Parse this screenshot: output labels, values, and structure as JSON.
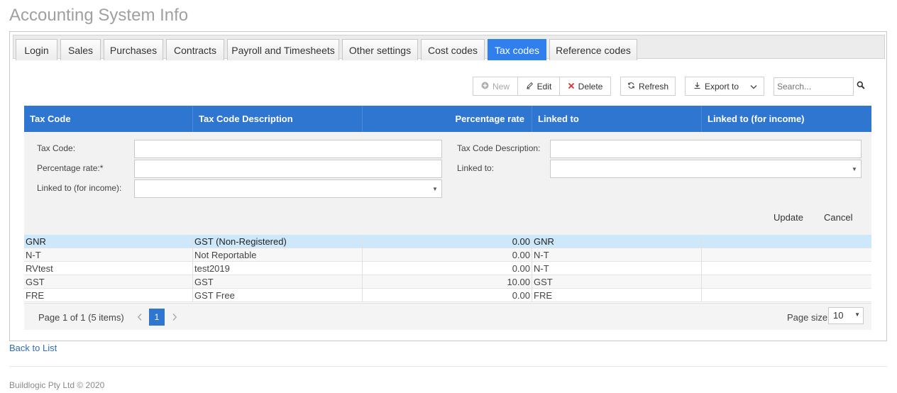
{
  "page": {
    "title": "Accounting System Info"
  },
  "tabs": [
    {
      "label": "Login"
    },
    {
      "label": "Sales"
    },
    {
      "label": "Purchases"
    },
    {
      "label": "Contracts"
    },
    {
      "label": "Payroll and Timesheets"
    },
    {
      "label": "Other settings"
    },
    {
      "label": "Cost codes"
    },
    {
      "label": "Tax codes",
      "active": true
    },
    {
      "label": "Reference codes"
    }
  ],
  "toolbar": {
    "new_label": "New",
    "edit_label": "Edit",
    "delete_label": "Delete",
    "refresh_label": "Refresh",
    "export_label": "Export to",
    "search_placeholder": "Search...",
    "accent_color": "#2e76cf",
    "delete_icon_color": "#d9302c"
  },
  "grid": {
    "columns": [
      "Tax Code",
      "Tax Code Description",
      "Percentage rate",
      "Linked to",
      "Linked to (for income)"
    ],
    "header_color": "#2e76cf",
    "rows": [
      {
        "code": "GNR",
        "description": "GST (Non-Registered)",
        "rate": "0.00",
        "linked": "GNR",
        "linked_income": "",
        "selected": true
      },
      {
        "code": "N-T",
        "description": "Not Reportable",
        "rate": "0.00",
        "linked": "N-T",
        "linked_income": ""
      },
      {
        "code": "RVtest",
        "description": "test2019",
        "rate": "0.00",
        "linked": "N-T",
        "linked_income": ""
      },
      {
        "code": "GST",
        "description": "GST",
        "rate": "10.00",
        "linked": "GST",
        "linked_income": ""
      },
      {
        "code": "FRE",
        "description": "GST Free",
        "rate": "0.00",
        "linked": "FRE",
        "linked_income": ""
      }
    ]
  },
  "form": {
    "tax_code_label": "Tax Code:",
    "tax_code_value": "",
    "description_label": "Tax Code Description:",
    "description_value": "",
    "rate_label": "Percentage rate:*",
    "rate_value": "",
    "linked_label": "Linked to:",
    "linked_value": "",
    "linked_income_label": "Linked to (for income):",
    "linked_income_value": "",
    "update_label": "Update",
    "cancel_label": "Cancel"
  },
  "pager": {
    "summary": "Page 1 of 1 (5 items)",
    "current_page": "1",
    "page_size_label": "Page size:",
    "page_size_value": "10"
  },
  "links": {
    "back": "Back to List"
  },
  "footer": {
    "text": "Buildlogic Pty Ltd © 2020"
  }
}
